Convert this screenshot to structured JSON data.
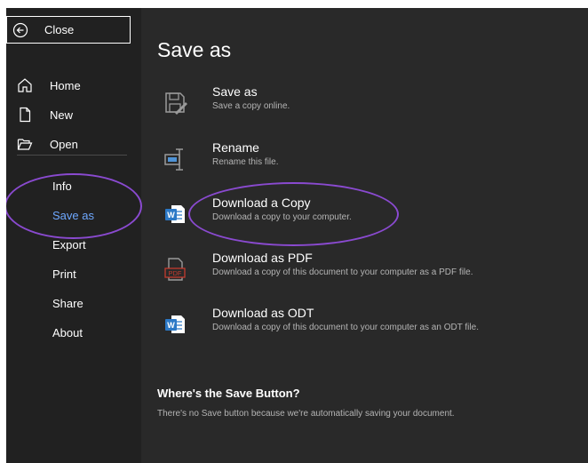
{
  "sidebar": {
    "close_label": "Close",
    "items": [
      {
        "label": "Home",
        "icon": "home-icon"
      },
      {
        "label": "New",
        "icon": "new-document-icon"
      },
      {
        "label": "Open",
        "icon": "open-folder-icon"
      },
      {
        "label": "Info"
      },
      {
        "label": "Save as"
      },
      {
        "label": "Export"
      },
      {
        "label": "Print"
      },
      {
        "label": "Share"
      },
      {
        "label": "About"
      }
    ],
    "active_item": "Save as"
  },
  "main": {
    "title": "Save as",
    "options": [
      {
        "title": "Save as",
        "desc": "Save a copy online.",
        "icon": "save-as-icon"
      },
      {
        "title": "Rename",
        "desc": "Rename this file.",
        "icon": "rename-icon"
      },
      {
        "title": "Download a Copy",
        "desc": "Download a copy to your computer.",
        "icon": "word-document-icon"
      },
      {
        "title": "Download as PDF",
        "desc": "Download a copy of this document to your computer as a PDF file.",
        "icon": "pdf-icon",
        "icon_text": "PDF"
      },
      {
        "title": "Download as ODT",
        "desc": "Download a copy of this document to your computer as an ODT file.",
        "icon": "odt-document-icon"
      }
    ],
    "footer": {
      "title": "Where's the Save Button?",
      "desc": "There's no Save button because we're automatically saving your document."
    }
  },
  "colors": {
    "background": "#292929",
    "sidebar": "#212121",
    "active": "#6ea8ff",
    "annotation": "#8a4ad0",
    "word_blue": "#2b78c6",
    "pdf_red": "#c43b2e"
  }
}
